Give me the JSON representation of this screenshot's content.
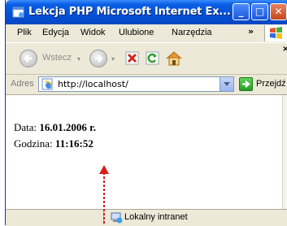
{
  "window": {
    "title": "Lekcja PHP  Microsoft Internet Ex...",
    "minimize": "_",
    "maximize": "□",
    "close": "✕"
  },
  "menu": {
    "items": [
      "Plik",
      "Edycja",
      "Widok",
      "Ulubione",
      "Narzędzia"
    ],
    "more": "»"
  },
  "toolbar": {
    "back_label": "Wstecz",
    "dropdown_glyph": "▾",
    "close_glyph": "×"
  },
  "address": {
    "label": "Adres",
    "url": "http://localhost/",
    "go_label": "Przejdź"
  },
  "content": {
    "date_label": "Data:",
    "date_value": "16.01.2006 r.",
    "time_label": "Godzina:",
    "time_value": "11:16:52"
  },
  "status": {
    "zone": "Lokalny intranet"
  },
  "colors": {
    "titlebar": "#0450d8",
    "chrome": "#ece9d8",
    "arrow": "#d81b1b"
  }
}
